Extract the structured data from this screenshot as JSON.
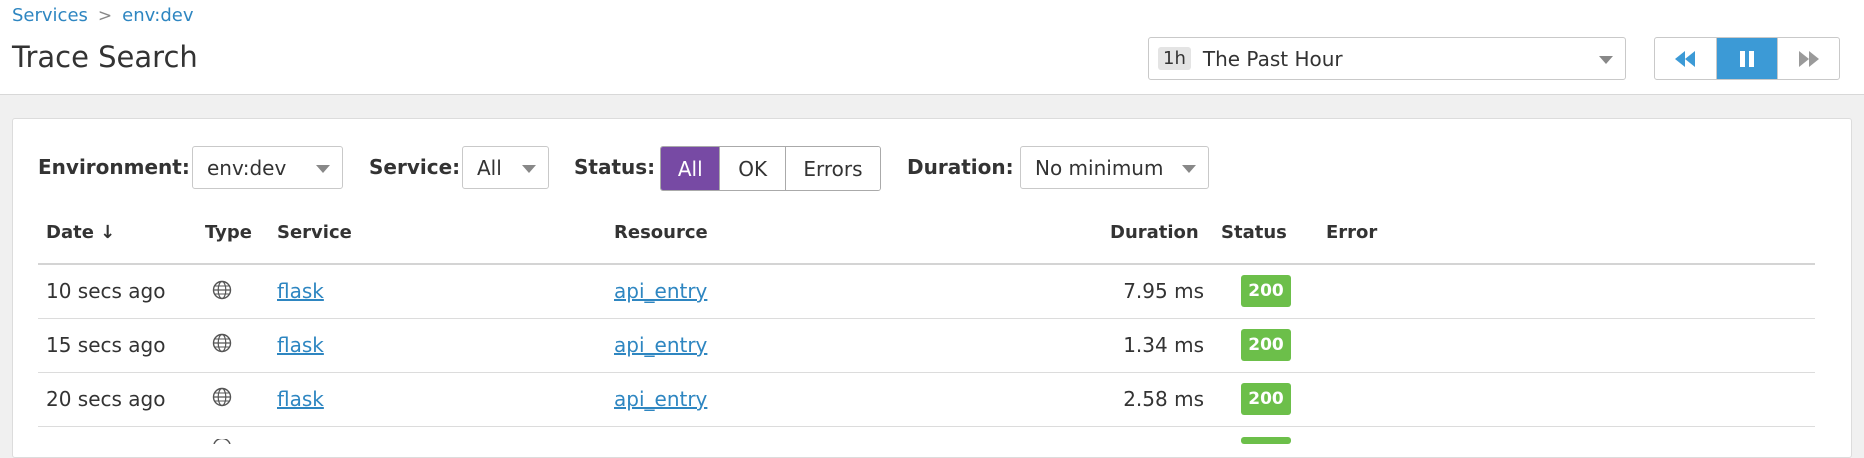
{
  "breadcrumb": {
    "services": "Services",
    "separator": ">",
    "env": "env:dev"
  },
  "page_title": "Trace Search",
  "time_range": {
    "badge": "1h",
    "label": "The Past Hour"
  },
  "playback": {
    "buttons": [
      "rewind-icon",
      "pause-icon",
      "fast-forward-icon"
    ],
    "active": "pause",
    "active_color": "#3c9ad6"
  },
  "filters": {
    "environment": {
      "label": "Environment:",
      "value": "env:dev"
    },
    "service": {
      "label": "Service:",
      "value": "All"
    },
    "status": {
      "label": "Status:",
      "options": [
        "All",
        "OK",
        "Errors"
      ],
      "selected": "All",
      "selected_color": "#774aa4"
    },
    "duration": {
      "label": "Duration:",
      "value": "No minimum"
    }
  },
  "table": {
    "headers": {
      "date": "Date ↓",
      "type": "Type",
      "service": "Service",
      "resource": "Resource",
      "duration": "Duration",
      "status": "Status",
      "error": "Error"
    },
    "rows": [
      {
        "date": "10 secs ago",
        "type": "globe-icon",
        "service": "flask",
        "resource": "api_entry",
        "duration": "7.95 ms",
        "status": "200"
      },
      {
        "date": "15 secs ago",
        "type": "globe-icon",
        "service": "flask",
        "resource": "api_entry",
        "duration": "1.34 ms",
        "status": "200"
      },
      {
        "date": "20 secs ago",
        "type": "globe-icon",
        "service": "flask",
        "resource": "api_entry",
        "duration": "2.58 ms",
        "status": "200"
      }
    ],
    "status_ok_color": "#6cbf4a",
    "link_color": "#2e86c1"
  }
}
